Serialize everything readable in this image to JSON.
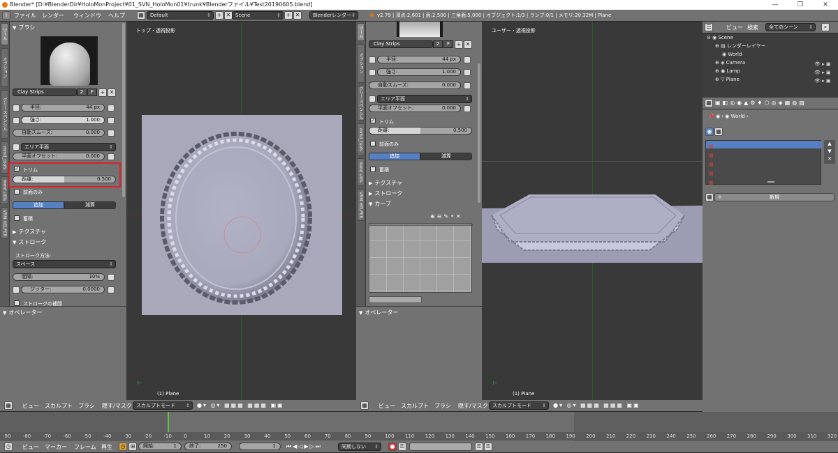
{
  "window": {
    "title": "Blender* [D:¥BlenderDir¥HoloMonProject¥01_SVN_HoloMon01¥trunk¥Blenderファイル¥Test20190605.blend]",
    "controls": [
      "—",
      "❐",
      "✕"
    ]
  },
  "info_header": {
    "menus": [
      "ファイル",
      "レンダー",
      "ウィンドウ",
      "ヘルプ"
    ],
    "layout": "Default",
    "scene": "Scene",
    "renderer": "Blenderレンダー",
    "stats": "v2.79 | 頂点:2,601 | 面:2,500 | 三角面:5,000 | オブジェクト:1/3 | ランプ:0/1 | メモリ:20.32M | Plane"
  },
  "left_tool_panel": {
    "tabs": [
      "ツール",
      "オプション",
      "グリースペンシル",
      "mmd_tools",
      "mmd utils",
      "VRM HELPER"
    ],
    "brush_header": "ブラシ",
    "brush_name": "Clay Strips",
    "brush_users": "2",
    "brush_fake": "F",
    "radius": {
      "label": "半径:",
      "value": "44 px"
    },
    "strength": {
      "label": "強さ:",
      "value": "1.000"
    },
    "autosmooth": {
      "label": "自動スムーズ:",
      "value": "0.000"
    },
    "area_plane": "エリア平面",
    "plane_offset": {
      "label": "平面オフセット:",
      "value": "0.000"
    },
    "trim": {
      "label": "トリム",
      "checked": true
    },
    "distance": {
      "label": "距離:",
      "value": "0.500",
      "fill": 0.5
    },
    "front_faces": "前面のみ",
    "add": "追加",
    "subtract": "減算",
    "accumulate": "蓄積",
    "texture": "テクスチャ",
    "stroke": "ストローク",
    "stroke_method_label": "ストローク方法:",
    "stroke_method": "スペース",
    "spacing": {
      "label": "間隔:",
      "value": "10%"
    },
    "jitter": {
      "label": "ジッター:",
      "value": "0.0000"
    },
    "stroke_complete": "ストロークの補間",
    "operator": "オペレーター"
  },
  "left_viewport": {
    "label": "トップ・透視投影",
    "object": "(1) Plane"
  },
  "right_tool_panel": {
    "tabs": [
      "ツール",
      "オプション",
      "グリースペンシル",
      "mmd_tools",
      "mmd utils",
      "VRM HELPER"
    ],
    "brush_name": "Clay Strips",
    "brush_users": "2",
    "brush_fake": "F",
    "radius": {
      "label": "半径:",
      "value": "44 px"
    },
    "strength": {
      "label": "強さ:",
      "value": "1.000"
    },
    "autosmooth": {
      "label": "自動スムーズ:",
      "value": "0.000"
    },
    "area_plane": "エリア平面",
    "plane_offset": {
      "label": "平面オフセット:",
      "value": "0.000"
    },
    "trim": "トリム",
    "distance": {
      "label": "距離:",
      "value": "0.500",
      "fill": 0.5
    },
    "front_faces": "前面のみ",
    "add": "追加",
    "subtract": "減算",
    "accumulate": "蓄積",
    "texture": "テクスチャ",
    "stroke": "ストローク",
    "curve": "カーブ",
    "operator": "オペレーター"
  },
  "right_viewport": {
    "label": "ユーザー・透視投影",
    "object": "(1) Plane"
  },
  "outliner": {
    "view": "ビュー",
    "search": "検索",
    "filter": "全てのシーン",
    "items": [
      "Scene",
      "レンダーレイヤー",
      "World",
      "Camera",
      "Lamp",
      "Plane"
    ]
  },
  "properties": {
    "breadcrumb": "World",
    "new_button": "新規"
  },
  "view3d_header": {
    "menus": [
      "ビュー",
      "スカルプト",
      "ブラシ",
      "隠す/マスク"
    ],
    "mode": "スカルプトモード"
  },
  "timeline": {
    "ticks": [
      "-90",
      "-80",
      "-70",
      "-60",
      "-50",
      "-40",
      "-30",
      "-20",
      "-10",
      "0",
      "10",
      "20",
      "30",
      "40",
      "50",
      "60",
      "70",
      "80",
      "90",
      "100",
      "110",
      "120",
      "130",
      "140",
      "150",
      "160",
      "170",
      "180",
      "190",
      "200",
      "210",
      "220",
      "230",
      "240",
      "250",
      "260",
      "270",
      "280",
      "290",
      "300",
      "310",
      "320"
    ],
    "menus": [
      "ビュー",
      "マーカー",
      "フレーム",
      "再生"
    ],
    "start": {
      "label": "開始:",
      "value": "1"
    },
    "end": {
      "label": "終了:",
      "value": "250"
    },
    "current": "1",
    "sync": "同期しない"
  }
}
